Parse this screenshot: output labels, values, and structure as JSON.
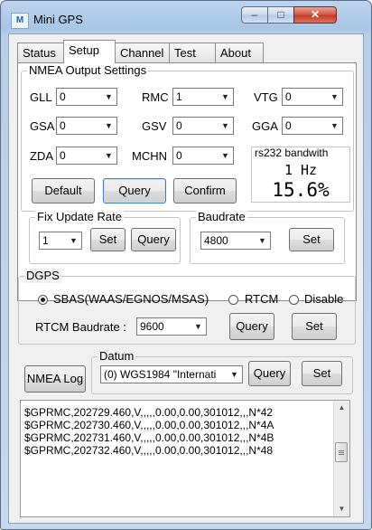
{
  "window": {
    "title": "Mini GPS",
    "icon": "gps-app-icon",
    "min": "–",
    "max": "□",
    "close": "✕"
  },
  "tabs": [
    "Status",
    "Setup",
    "Channel",
    "Test",
    "About"
  ],
  "nmea": {
    "title": "NMEA Output Settings",
    "fields": [
      {
        "label": "GLL",
        "value": "0"
      },
      {
        "label": "RMC",
        "value": "1"
      },
      {
        "label": "VTG",
        "value": "0"
      },
      {
        "label": "GSA",
        "value": "0"
      },
      {
        "label": "GSV",
        "value": "0"
      },
      {
        "label": "GGA",
        "value": "0"
      },
      {
        "label": "ZDA",
        "value": "0"
      },
      {
        "label": "MCHN",
        "value": "0"
      }
    ],
    "default_label": "Default",
    "query_label": "Query",
    "confirm_label": "Confirm"
  },
  "bandwidth": {
    "title": "rs232 bandwith",
    "hz": "1  Hz",
    "percent": "15.6%"
  },
  "fix_rate": {
    "title": "Fix Update Rate",
    "value": "1",
    "set_label": "Set",
    "query_label": "Query"
  },
  "baudrate": {
    "title": "Baudrate",
    "value": "4800",
    "set_label": "Set"
  },
  "dgps": {
    "title": "DGPS",
    "options": [
      "SBAS(WAAS/EGNOS/MSAS)",
      "RTCM",
      "Disable"
    ],
    "selected": "SBAS(WAAS/EGNOS/MSAS)",
    "rtcm_label": "RTCM Baudrate :",
    "rtcm_value": "9600",
    "query_label": "Query",
    "set_label": "Set"
  },
  "nmea_log_label": "NMEA Log",
  "datum": {
    "title": "Datum",
    "value": "(0) WGS1984 \"Internati",
    "query_label": "Query",
    "set_label": "Set"
  },
  "log_lines": [
    "$GPRMC,202729.460,V,,,,,0.00,0.00,301012,,,N*42",
    "$GPRMC,202730.460,V,,,,,0.00,0.00,301012,,,N*4A",
    "$GPRMC,202731.460,V,,,,,0.00,0.00,301012,,,N*4B",
    "$GPRMC,202732.460,V,,,,,0.00,0.00,301012,,,N*48"
  ]
}
